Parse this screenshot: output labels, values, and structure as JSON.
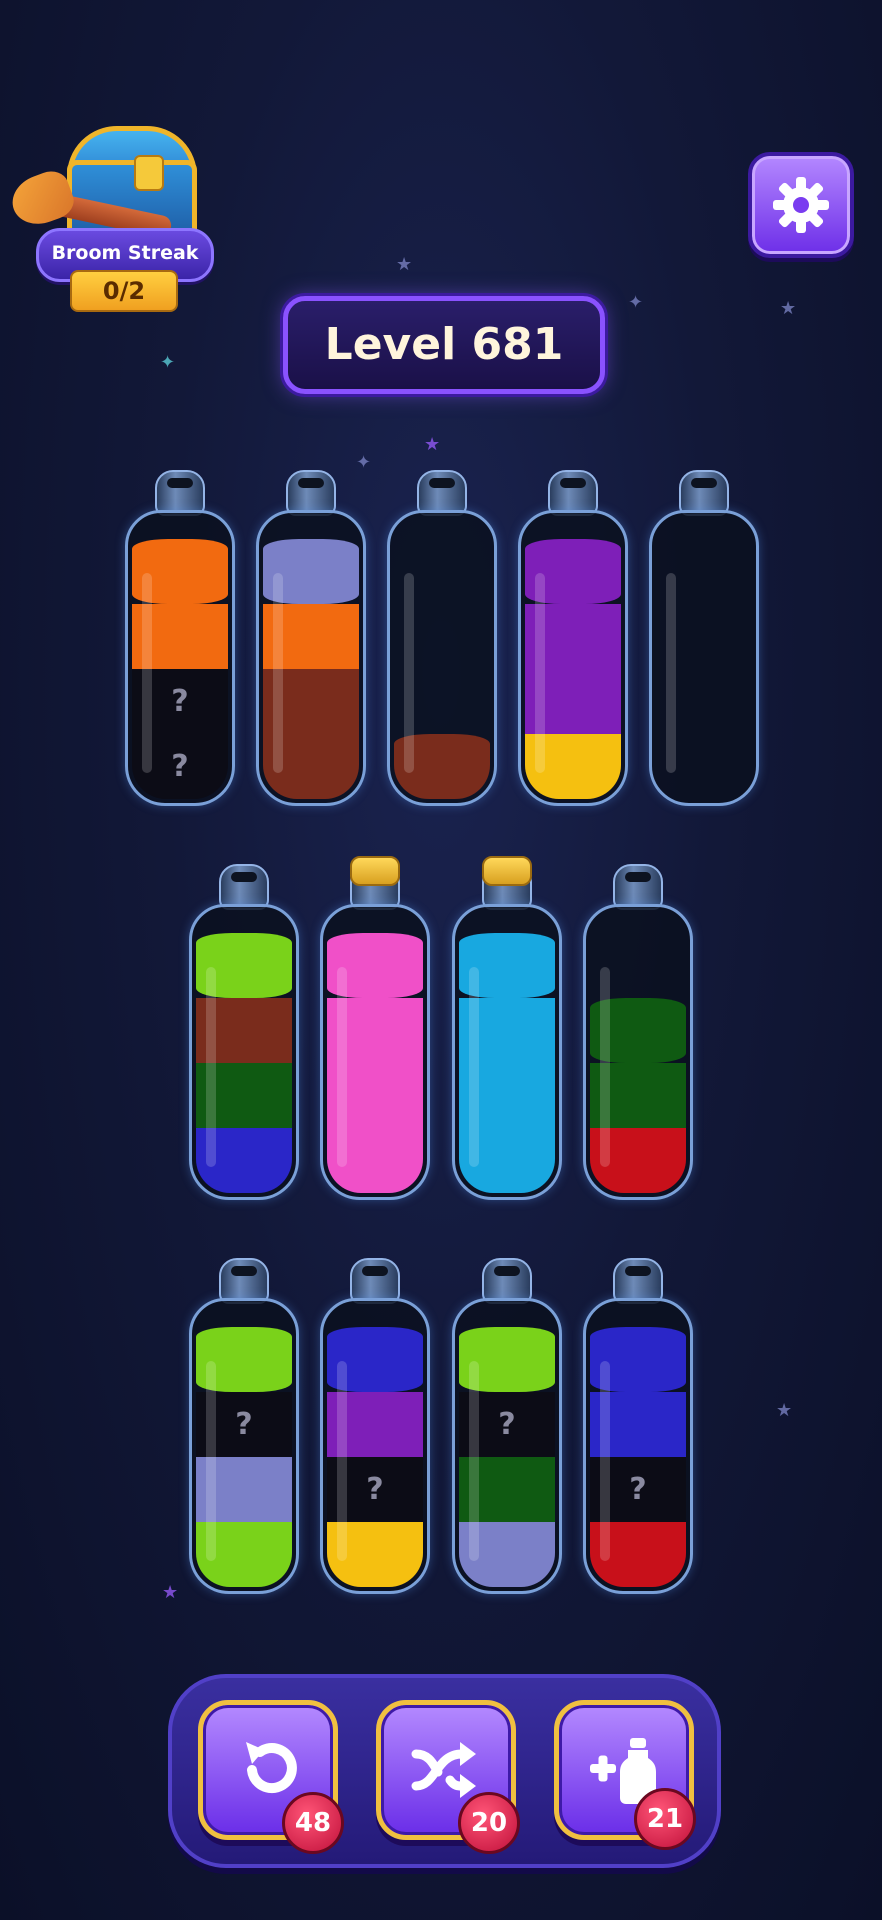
{
  "broom_streak": {
    "label": "Broom Streak",
    "count": "0/2"
  },
  "settings": {
    "icon": "gear-icon"
  },
  "level": {
    "label": "Level 681"
  },
  "hidden_mark": "?",
  "colors": {
    "orange": "#f26a10",
    "lavender": "#7b80c8",
    "brown": "#7a2c1c",
    "purple": "#7e1fb8",
    "yellow": "#f5c010",
    "lime": "#7ad21a",
    "darkgreen": "#0f5a12",
    "blue": "#2a26c8",
    "pink": "#f050c8",
    "cyan": "#18a8e0",
    "red": "#c8101a",
    "hidden": "#0c0c16"
  },
  "bottles": [
    {
      "row": 1,
      "capped": false,
      "layers": [
        "hidden",
        "hidden",
        "orange",
        "orange"
      ]
    },
    {
      "row": 1,
      "capped": false,
      "layers": [
        "brown",
        "brown",
        "orange",
        "lavender"
      ]
    },
    {
      "row": 1,
      "capped": false,
      "layers": [
        "brown"
      ]
    },
    {
      "row": 1,
      "capped": false,
      "layers": [
        "yellow",
        "purple",
        "purple",
        "purple"
      ]
    },
    {
      "row": 1,
      "capped": false,
      "layers": []
    },
    {
      "row": 2,
      "capped": false,
      "layers": [
        "blue",
        "darkgreen",
        "brown",
        "lime"
      ]
    },
    {
      "row": 2,
      "capped": true,
      "layers": [
        "pink",
        "pink",
        "pink",
        "pink"
      ]
    },
    {
      "row": 2,
      "capped": true,
      "layers": [
        "cyan",
        "cyan",
        "cyan",
        "cyan"
      ]
    },
    {
      "row": 2,
      "capped": false,
      "layers": [
        "red",
        "darkgreen",
        "darkgreen"
      ]
    },
    {
      "row": 3,
      "capped": false,
      "layers": [
        "lime",
        "lavender",
        "hidden",
        "lime"
      ]
    },
    {
      "row": 3,
      "capped": false,
      "layers": [
        "yellow",
        "hidden",
        "purple",
        "blue"
      ]
    },
    {
      "row": 3,
      "capped": false,
      "layers": [
        "lavender",
        "darkgreen",
        "hidden",
        "lime"
      ]
    },
    {
      "row": 3,
      "capped": false,
      "layers": [
        "red",
        "hidden",
        "blue",
        "blue"
      ]
    }
  ],
  "tools": [
    {
      "name": "undo",
      "icon": "undo-icon",
      "count": "48"
    },
    {
      "name": "shuffle",
      "icon": "shuffle-icon",
      "count": "20"
    },
    {
      "name": "add-bottle",
      "icon": "add-bottle-icon",
      "count": "21"
    }
  ]
}
